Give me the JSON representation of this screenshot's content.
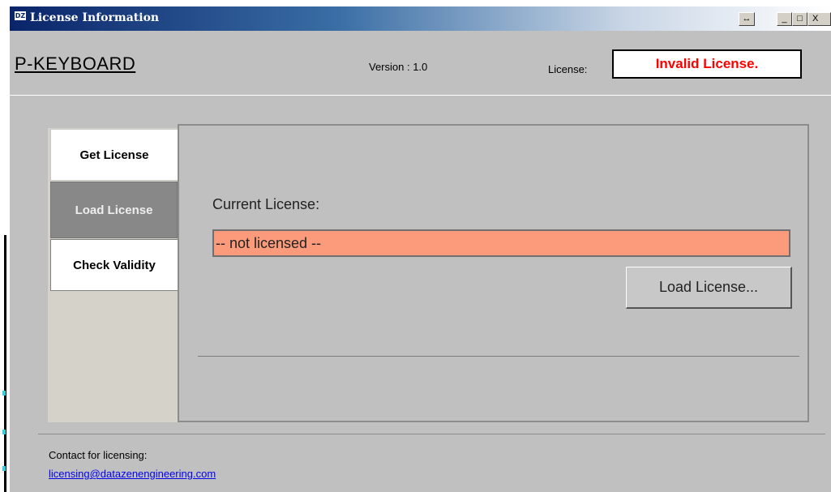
{
  "window": {
    "title": "License Information",
    "logo_text": "DZ",
    "buttons": {
      "resize": "↔",
      "minimize": "_",
      "maximize": "□",
      "close": "X"
    }
  },
  "header": {
    "product": "P-KEYBOARD",
    "version": "Version : 1.0",
    "license_label": "License:",
    "license_status": "Invalid License.",
    "license_status_color": "#ff0000"
  },
  "tabs": [
    {
      "label": "Get License",
      "active": false
    },
    {
      "label": "Load License",
      "active": true
    },
    {
      "label": "Check Validity",
      "active": false
    }
  ],
  "panel": {
    "current_label": "Current License:",
    "current_value": "-- not licensed --",
    "field_color": "#fb9b7b",
    "load_button": "Load License..."
  },
  "footer": {
    "contact_label": "Contact for licensing:",
    "email": "licensing@datazenengineering.com"
  }
}
